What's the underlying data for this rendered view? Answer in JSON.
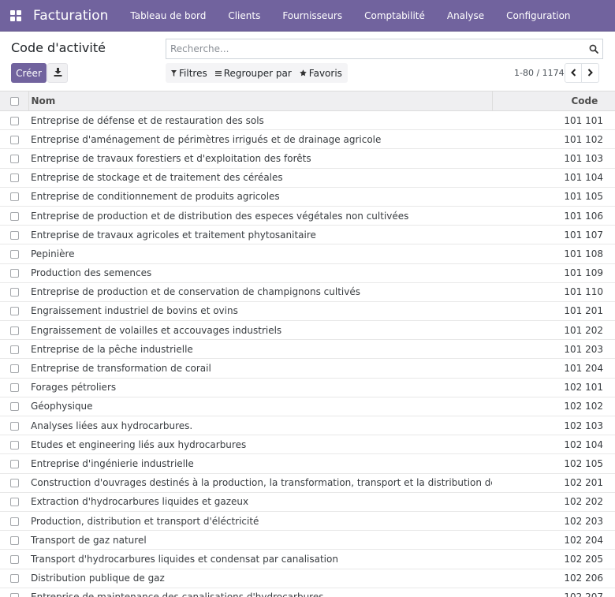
{
  "navbar": {
    "app_title": "Facturation",
    "menu": [
      {
        "label": "Tableau de bord"
      },
      {
        "label": "Clients"
      },
      {
        "label": "Fournisseurs"
      },
      {
        "label": "Comptabilité"
      },
      {
        "label": "Analyse"
      },
      {
        "label": "Configuration"
      }
    ],
    "color": "#71639e"
  },
  "control_panel": {
    "title": "Code d'activité",
    "search_placeholder": "Recherche...",
    "create_label": "Créer",
    "filters": [
      {
        "label": "Filtres",
        "icon": "filter-icon"
      },
      {
        "label": "Regrouper par",
        "icon": "group-by-icon"
      },
      {
        "label": "Favoris",
        "icon": "star-icon"
      }
    ],
    "pager": {
      "value": "1-80 / 1174"
    }
  },
  "table": {
    "columns": {
      "name": "Nom",
      "code": "Code"
    },
    "rows": [
      {
        "name": "Entreprise de défense et de restauration des sols",
        "code": "101 101"
      },
      {
        "name": "Entreprise d'aménagement de périmètres irrigués et de drainage agricole",
        "code": "101 102"
      },
      {
        "name": "Entreprise de travaux forestiers et d'exploitation des forêts",
        "code": "101 103"
      },
      {
        "name": "Entreprise de stockage et de traitement des céréales",
        "code": "101 104"
      },
      {
        "name": "Entreprise de conditionnement de produits agricoles",
        "code": "101 105"
      },
      {
        "name": "Entreprise de production et de distribution des especes végétales non cultivées",
        "code": "101 106"
      },
      {
        "name": "Entreprise de travaux agricoles et traitement phytosanitaire",
        "code": "101 107"
      },
      {
        "name": "Pepinière",
        "code": "101 108"
      },
      {
        "name": "Production des semences",
        "code": "101 109"
      },
      {
        "name": "Entreprise de production et de conservation de champignons cultivés",
        "code": "101 110"
      },
      {
        "name": "Engraissement industriel de bovins et ovins",
        "code": "101 201"
      },
      {
        "name": "Engraissement de volailles et accouvages industriels",
        "code": "101 202"
      },
      {
        "name": "Entreprise de la pêche industrielle",
        "code": "101 203"
      },
      {
        "name": "Entreprise de transformation de corail",
        "code": "101 204"
      },
      {
        "name": "Forages pétroliers",
        "code": "102 101"
      },
      {
        "name": "Géophysique",
        "code": "102 102"
      },
      {
        "name": "Analyses liées aux hydrocarbures.",
        "code": "102 103"
      },
      {
        "name": "Etudes et engineering liés aux hydrocarbures",
        "code": "102 104"
      },
      {
        "name": "Entreprise d'ingénierie industrielle",
        "code": "102 105"
      },
      {
        "name": "Construction d'ouvrages destinés à la production, la transformation, transport et la distribution des hydrocarbures",
        "code": "102 201"
      },
      {
        "name": "Extraction d'hydrocarbures liquides et gazeux",
        "code": "102 202"
      },
      {
        "name": "Production, distribution et transport d'éléctricité",
        "code": "102 203"
      },
      {
        "name": "Transport de gaz naturel",
        "code": "102 204"
      },
      {
        "name": "Transport d'hydrocarbures liquides et condensat par canalisation",
        "code": "102 205"
      },
      {
        "name": "Distribution publique de gaz",
        "code": "102 206"
      },
      {
        "name": "Entreprise de maintenance des canalisations d'hydrocarbures",
        "code": "102 207"
      }
    ]
  }
}
